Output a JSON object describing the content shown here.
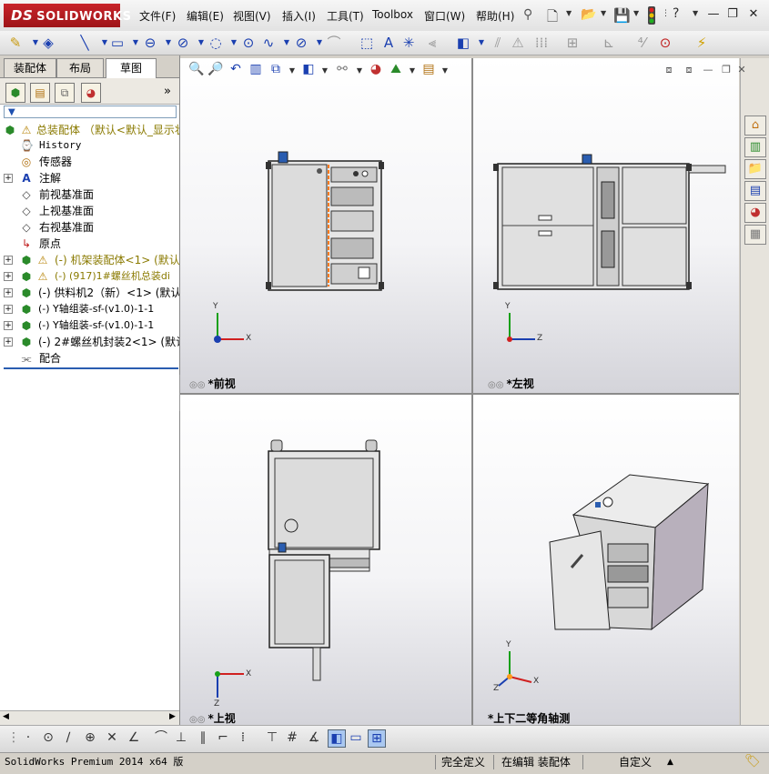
{
  "app": {
    "brand": "SOLIDWORKS",
    "brand_prefix": "DS"
  },
  "menu": {
    "items": [
      "文件(F)",
      "编辑(E)",
      "视图(V)",
      "插入(I)",
      "工具(T)",
      "Toolbox",
      "窗口(W)",
      "帮助(H)"
    ]
  },
  "panel": {
    "tabs": [
      "装配体",
      "布局",
      "草图"
    ],
    "active_tab": "草图",
    "expand_glyph": "»",
    "filter_glyph": "▼",
    "tree": [
      {
        "label": "总装配体  （默认<默认_显示状",
        "icon": "assembly-warning-icon",
        "color": "#8a7a00"
      },
      {
        "label": "History",
        "icon": "history-icon"
      },
      {
        "label": "传感器",
        "icon": "sensor-icon"
      },
      {
        "label": "注解",
        "icon": "annotation-icon"
      },
      {
        "label": "前视基准面",
        "icon": "plane-icon"
      },
      {
        "label": "上视基准面",
        "icon": "plane-icon"
      },
      {
        "label": "右视基准面",
        "icon": "plane-icon"
      },
      {
        "label": "原点",
        "icon": "origin-icon"
      },
      {
        "label": "(-) 机架装配体<1> (默认",
        "icon": "subassembly-warning-icon",
        "color": "#8a7a00"
      },
      {
        "label": "(-) (917)1#螺丝机总装di",
        "icon": "subassembly-warning-icon",
        "color": "#8a7a00"
      },
      {
        "label": "(-) 供料机2（新）<1> (默认",
        "icon": "subassembly-icon"
      },
      {
        "label": "(-) Y轴组装-sf-(v1.0)-1-1",
        "icon": "subassembly-icon"
      },
      {
        "label": "(-) Y轴组装-sf-(v1.0)-1-1",
        "icon": "subassembly-icon"
      },
      {
        "label": "(-) 2#螺丝机封装2<1> (默认",
        "icon": "subassembly-icon"
      },
      {
        "label": "配合",
        "icon": "mates-icon"
      }
    ]
  },
  "viewports": {
    "front": {
      "label": "*前视",
      "axis_x": "X",
      "axis_y": "Y"
    },
    "left": {
      "label": "*左视",
      "axis_x": "Z",
      "axis_y": "Y"
    },
    "top": {
      "label": "*上视",
      "axis_x": "X",
      "axis_y": "Z"
    },
    "iso": {
      "label": "*上下二等角轴测",
      "axis_x": "X",
      "axis_y": "Y",
      "axis_z": "Z"
    }
  },
  "status": {
    "product": "SolidWorks Premium 2014 x64 版",
    "definition": "完全定义",
    "mode": "在编辑 装配体",
    "units": "自定义"
  }
}
